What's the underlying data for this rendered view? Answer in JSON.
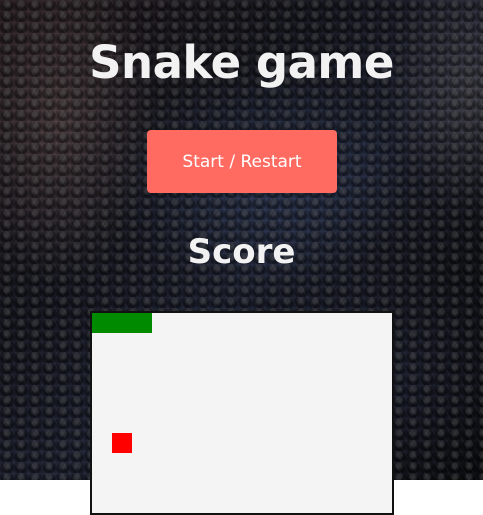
{
  "game": {
    "title": "Snake game",
    "start_button_label": "Start / Restart",
    "score_label": "Score"
  },
  "colors": {
    "button_bg": "#ff6b61",
    "board_bg": "#f4f4f4",
    "snake": "#008a00",
    "food": "#ff0000",
    "title_text": "#f2f2f2"
  }
}
